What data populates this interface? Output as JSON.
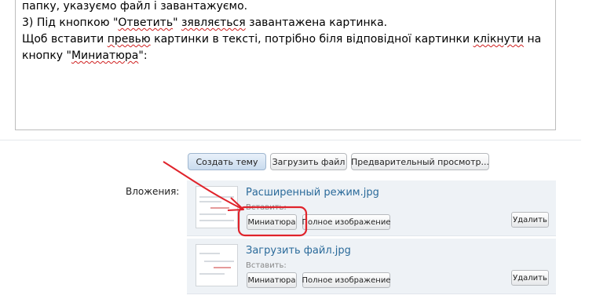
{
  "editor": {
    "lines": [
      [
        "папку, указуємо файл і завантажуємо."
      ],
      [
        "3) Під кнопкою \"",
        {
          "t": "Ответить",
          "sp": true
        },
        "\" ",
        {
          "t": "зявляється",
          "sp": true
        },
        " завантажена картинка."
      ],
      [
        "Щоб вставити ",
        {
          "t": "превью",
          "sp": true
        },
        " картинки в тексті, потрібно біля відповідної картинки ",
        {
          "t": "клікнути",
          "sp": true
        },
        " на"
      ],
      [
        "кнопку \"",
        {
          "t": "Миниатюра",
          "sp": true
        },
        "\":"
      ]
    ]
  },
  "toolbar": {
    "create_topic": "Создать тему",
    "upload_file": "Загрузить файл",
    "preview": "Предварительный просмотр..."
  },
  "attachments": {
    "label": "Вложения:",
    "items": [
      {
        "file_name": "Расширенный режим.jpg",
        "insert_label": "Вставить:",
        "thumbnail_button": "Миниатюра",
        "full_image_button": "Полное изображение",
        "delete_button": "Удалить"
      },
      {
        "file_name": "Загрузить файл.jpg",
        "insert_label": "Вставить:",
        "thumbnail_button": "Миниатюра",
        "full_image_button": "Полное изображение",
        "delete_button": "Удалить"
      }
    ]
  },
  "colors": {
    "annotation": "#e0232b",
    "link": "#2a6a9a",
    "row_background": "#eef2f6"
  }
}
